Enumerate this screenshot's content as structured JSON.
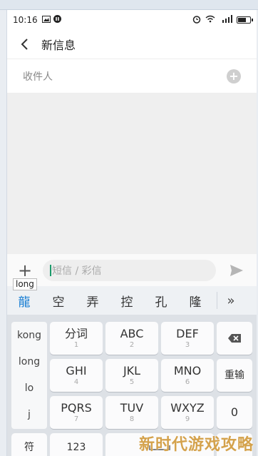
{
  "status": {
    "time": "10:16"
  },
  "header": {
    "title": "新信息"
  },
  "recipient": {
    "label": "收件人"
  },
  "compose": {
    "placeholder": "短信 / 彩信"
  },
  "ime": {
    "composing": "long",
    "candidates": [
      "龍",
      "空",
      "弄",
      "控",
      "孔",
      "隆"
    ],
    "pinyin": [
      "kong",
      "long",
      "lo",
      "j"
    ],
    "keys": {
      "fenci": {
        "label": "分词",
        "num": "1"
      },
      "abc": {
        "label": "ABC",
        "num": "2"
      },
      "def": {
        "label": "DEF",
        "num": "3"
      },
      "ghi": {
        "label": "GHI",
        "num": "4"
      },
      "jkl": {
        "label": "JKL",
        "num": "5"
      },
      "mno": {
        "label": "MNO",
        "num": "6"
      },
      "pqrs": {
        "label": "PQRS",
        "num": "7"
      },
      "tuv": {
        "label": "TUV",
        "num": "8"
      },
      "wxyz": {
        "label": "WXYZ",
        "num": "9"
      },
      "reenter": "重输",
      "zero": "0",
      "symbol": "符",
      "num123": "123"
    }
  },
  "watermark": "新时代游戏攻略",
  "colors": {
    "accent": "#1a7fd3",
    "cursor": "#1a9a6a",
    "watermark": "#d4a24c"
  }
}
